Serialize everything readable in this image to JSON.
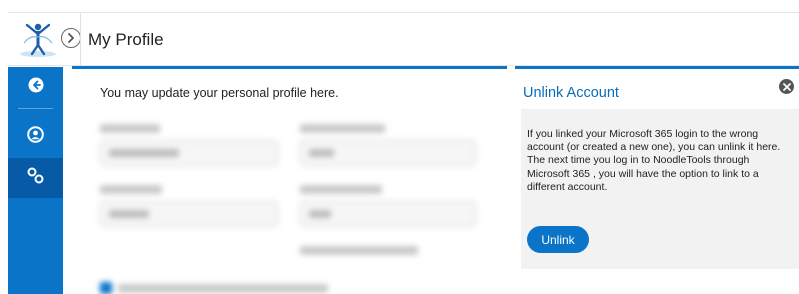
{
  "header": {
    "title": "My Profile",
    "logo_icon": "noodletools-logo-icon",
    "expand_icon": "chevron-right-circle-icon"
  },
  "sidebar": {
    "items": [
      {
        "icon": "arrow-left-circle-icon"
      },
      {
        "icon": "user-circle-icon"
      },
      {
        "icon": "link-icon",
        "active": true
      }
    ]
  },
  "main": {
    "intro": "You may update your personal profile here."
  },
  "unlink_panel": {
    "title": "Unlink Account",
    "body": "If you linked your Microsoft 365 login to the wrong account (or created a new one), you can unlink it here. The next time you log in to NoodleTools through Microsoft 365 , you will have the option to link to a different account.",
    "button_label": "Unlink",
    "close_icon": "close-circle-icon"
  },
  "colors": {
    "accent": "#0a74c9",
    "accent_dark": "#075aa5",
    "title_blue": "#0a6cb8",
    "panel_gray": "#f2f2f2"
  }
}
